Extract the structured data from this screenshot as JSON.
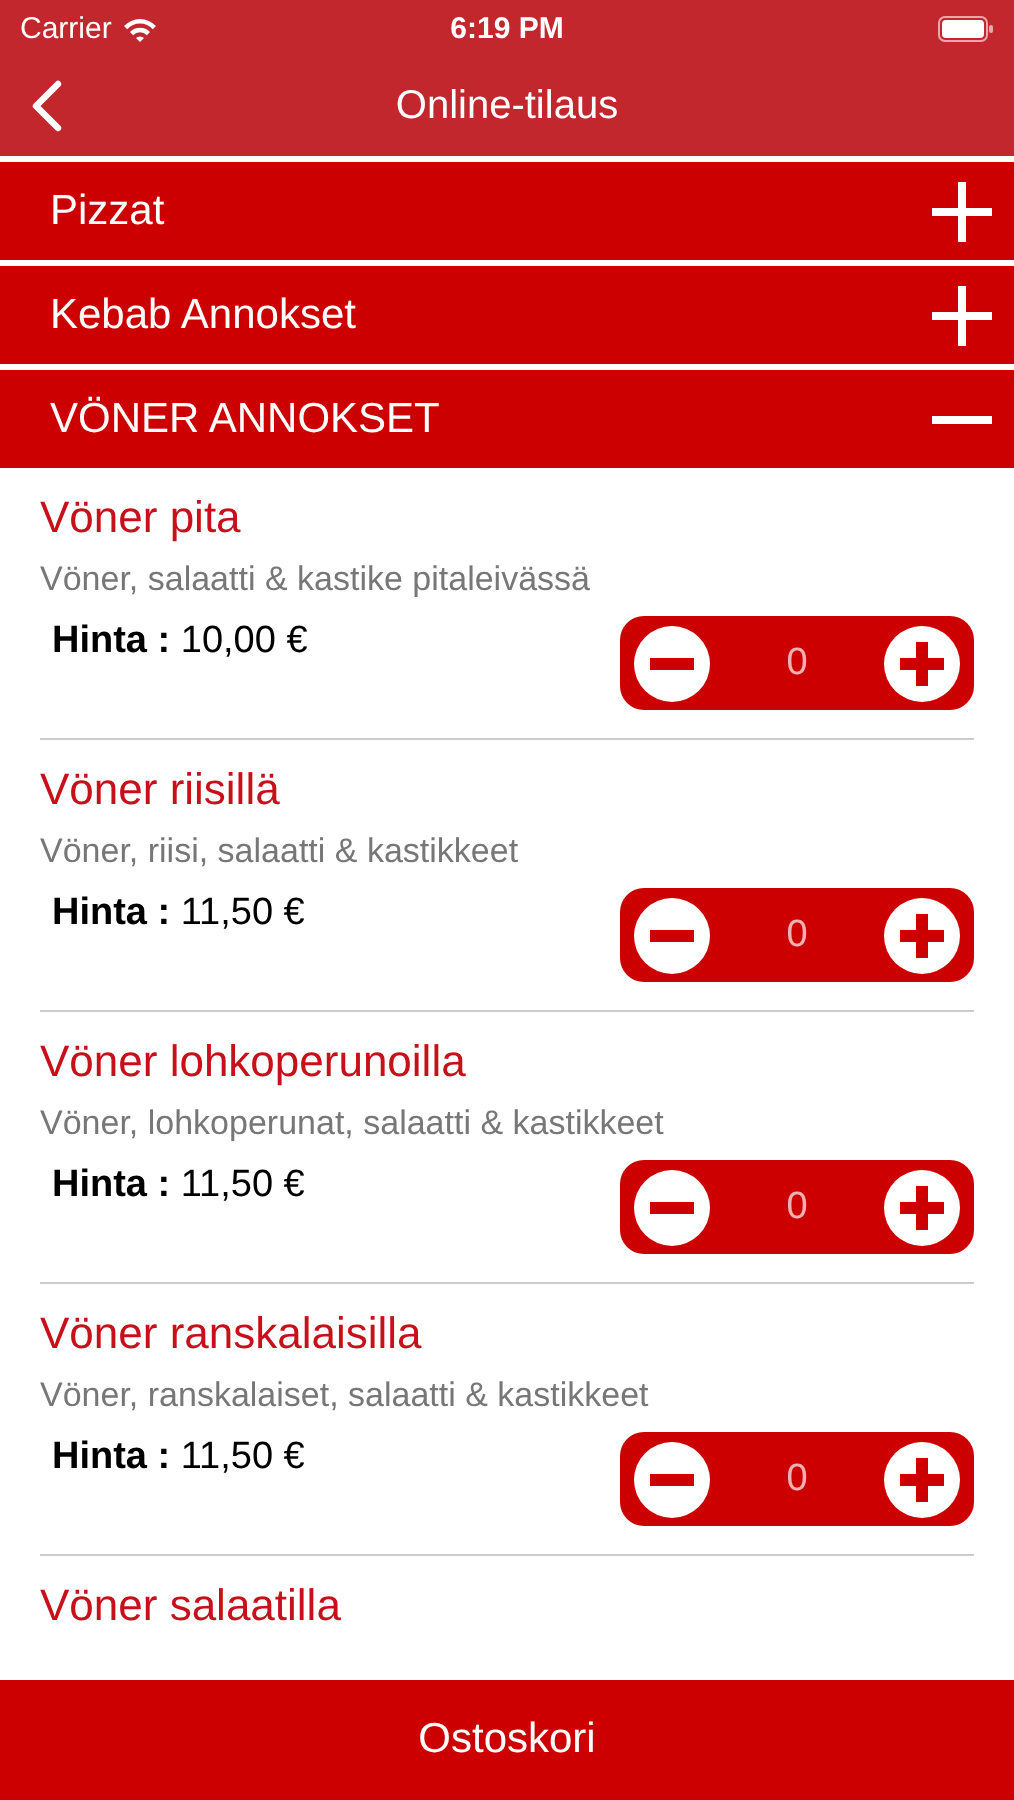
{
  "status_bar": {
    "carrier": "Carrier",
    "time": "6:19 PM"
  },
  "nav": {
    "title": "Online-tilaus"
  },
  "categories": [
    {
      "label": "Pizzat",
      "expanded": false
    },
    {
      "label": "Kebab Annokset",
      "expanded": false
    },
    {
      "label": "VÖNER ANNOKSET",
      "expanded": true
    }
  ],
  "items": [
    {
      "name": "Vöner pita",
      "description": "Vöner, salaatti & kastike pitaleivässä",
      "price": "**Hinta :** 10,00 €",
      "count": "0"
    },
    {
      "name": "Vöner riisillä",
      "description": "Vöner, riisi, salaatti & kastikkeet",
      "price": "**Hinta :** 11,50 €",
      "count": "0"
    },
    {
      "name": "Vöner lohkoperunoilla",
      "description": "Vöner, lohkoperunat, salaatti & kastikkeet",
      "price": "**Hinta :** 11,50 €",
      "count": "0"
    },
    {
      "name": "Vöner ranskalaisilla",
      "description": "Vöner, ranskalaiset, salaatti & kastikkeet",
      "price": "**Hinta :** 11,50 €",
      "count": "0"
    },
    {
      "name": "Vöner salaatilla"
    }
  ],
  "footer": {
    "label": "Ostoskori"
  }
}
